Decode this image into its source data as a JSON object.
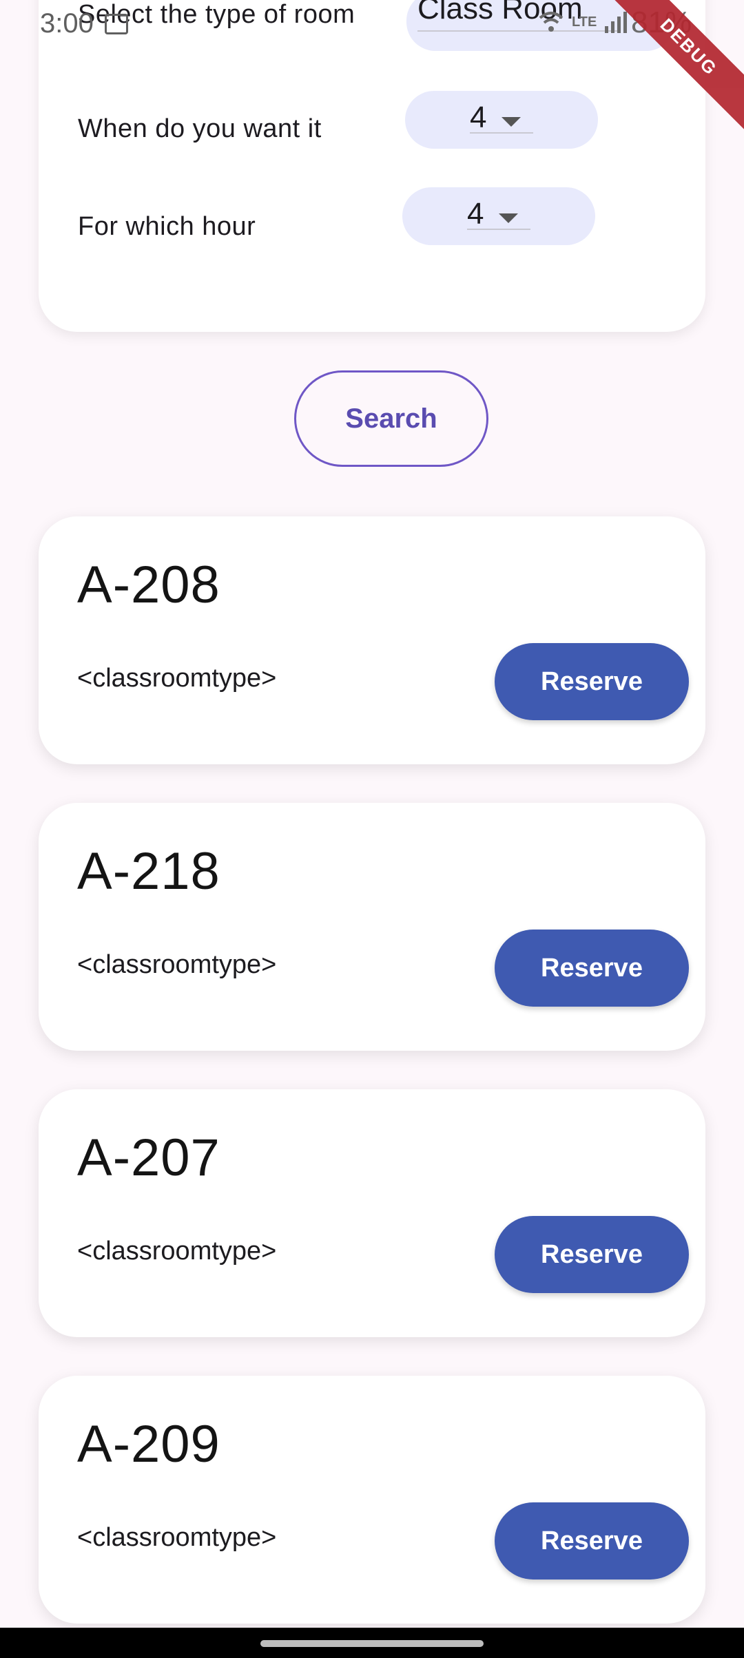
{
  "status_bar": {
    "time": "3:00",
    "battery": "81%",
    "debug_banner": "DEBUG",
    "network_label": "LTE"
  },
  "filters": {
    "room_type_label": "Select the type of room",
    "room_type_value": "Class Room",
    "when_label": "When do you want it",
    "when_value": "4",
    "hour_label": "For which hour",
    "hour_value": "4"
  },
  "search_label": "Search",
  "rooms": [
    {
      "name": "A-208",
      "type": "<classroomtype>",
      "action": "Reserve"
    },
    {
      "name": "A-218",
      "type": "<classroomtype>",
      "action": "Reserve"
    },
    {
      "name": "A-207",
      "type": "<classroomtype>",
      "action": "Reserve"
    },
    {
      "name": "A-209",
      "type": "<classroomtype>",
      "action": "Reserve"
    }
  ],
  "colors": {
    "accent": "#3f5ab1",
    "search_outline": "#6f57c6",
    "pill_bg": "#e8eafc",
    "background": "#fdf7fb"
  }
}
